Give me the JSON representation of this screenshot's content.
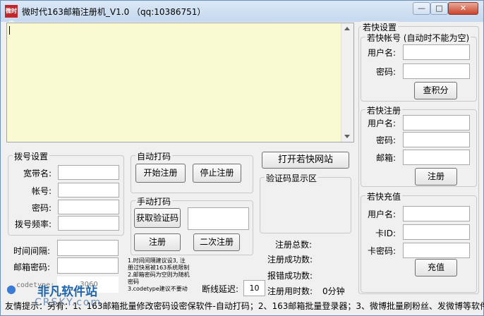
{
  "window": {
    "title": "微时代163邮箱注册机_V1.0  （qq:10386751）",
    "app_icon_text": "微时代",
    "min_label": "—",
    "max_label": "□",
    "close_label": "✕"
  },
  "dial": {
    "group_label": "拨号设置",
    "broadband_label": "宽带名:",
    "account_label": "帐号:",
    "password_label": "密码:",
    "frequency_label": "拨号频率:",
    "interval_label": "时间间隔:",
    "email_pwd_label": "邮箱密码:",
    "codetype_label": "codetype:",
    "codetype_value": "3060"
  },
  "auto_code": {
    "group_label": "自动打码",
    "start_button": "开始注册",
    "stop_button": "停止注册"
  },
  "manual_code": {
    "group_label": "手动打码",
    "get_code_button": "获取验证码",
    "register_button": "注册",
    "second_register_button": "二次注册"
  },
  "notes": [
    "1.时间间隔建议设3, 注",
    "册过快易被163系统限制",
    "2.邮箱密码为空则为随机",
    "密码",
    "3.codetype建议不要动"
  ],
  "open_site_button": "打开若快网站",
  "captcha": {
    "group_label": "验证码显示区"
  },
  "stats": {
    "total_label": "注册总数:",
    "success_label": "注册成功数:",
    "error_label": "报错成功数:",
    "time_label": "注册用时数:",
    "time_value": "0分钟",
    "disconnect_label": "断线延迟:",
    "disconnect_value": "10"
  },
  "ruokuai": {
    "group_label": "若快设置",
    "account": {
      "group_label": "若快帐号 (自动时不能为空)",
      "username_label": "用户名:",
      "password_label": "密码:",
      "check_points_button": "查积分"
    },
    "register": {
      "group_label": "若快注册",
      "username_label": "用户名:",
      "password_label": "密码:",
      "email_label": "邮箱:",
      "register_button": "注册"
    },
    "recharge": {
      "group_label": "若快充值",
      "username_label": "用户名:",
      "card_id_label": "卡ID:",
      "card_pwd_label": "卡密码:",
      "recharge_button": "充值"
    }
  },
  "status_bar": "友情提示：另有：1、163邮箱批量修改密码设密保软件-自动打码；2、163邮箱批量登录器；3、微博批量刷粉丝、发微博等软件",
  "watermark": {
    "line1": "非凡软件站",
    "line2": "CRSKY.com"
  }
}
